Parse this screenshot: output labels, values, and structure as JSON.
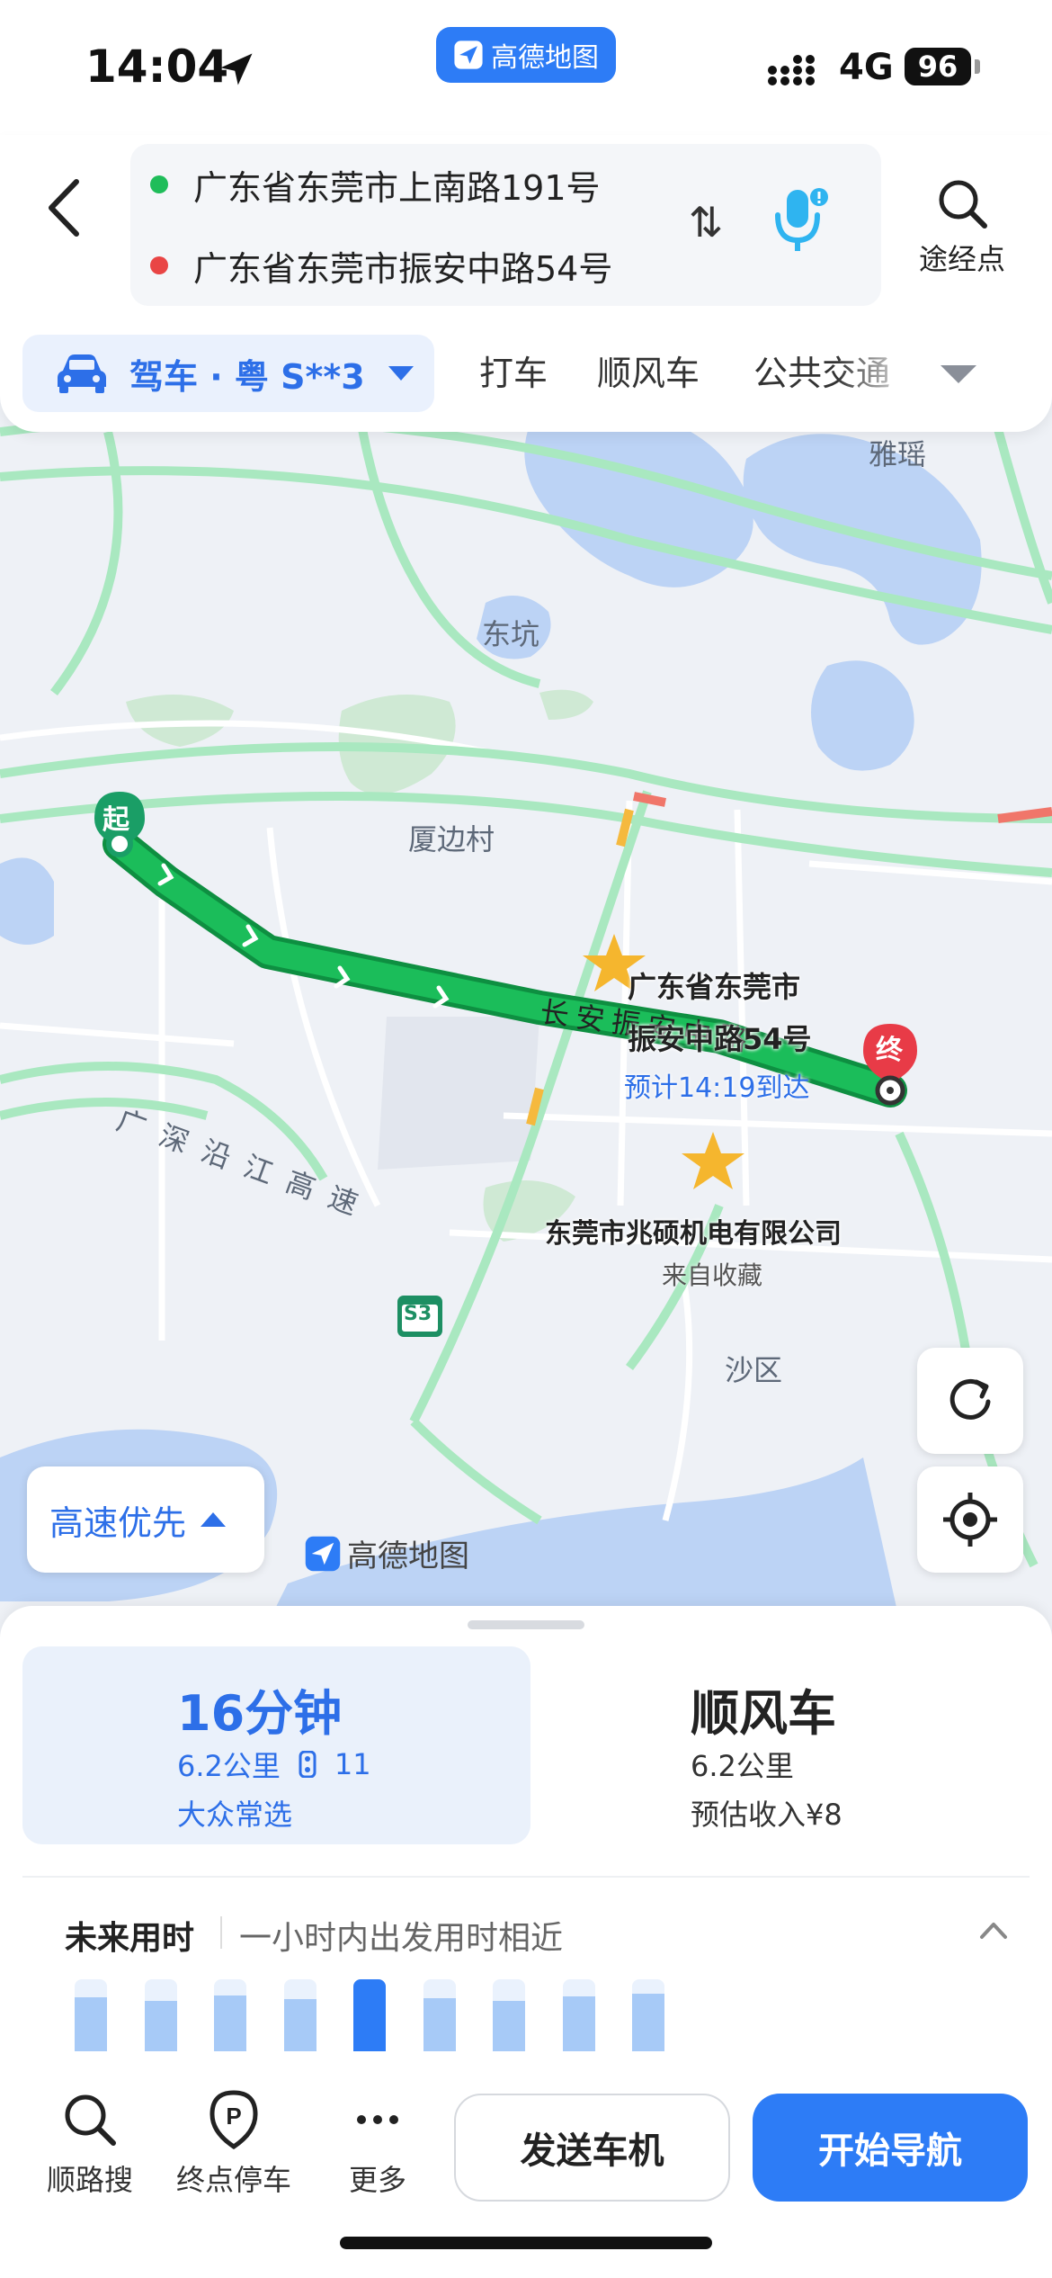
{
  "status_bar": {
    "time": "14:04",
    "network": "4G",
    "battery": "96"
  },
  "app": {
    "name": "高德地图"
  },
  "route": {
    "start": "广东省东莞市上南路191号",
    "end": "广东省东莞市振安中路54号",
    "swap_icon": "⇅",
    "via_label": "途经点",
    "icons": {
      "back": "chevron-left-icon",
      "voice": "microphone-icon",
      "via": "search-icon"
    }
  },
  "modes": {
    "active": "驾车 · 粤 S**3",
    "tabs": [
      "打车",
      "顺风车",
      "公共交通"
    ]
  },
  "map": {
    "places": [
      "雅瑶",
      "东坑",
      "厦边村",
      "沙区"
    ],
    "road_name": "长安振安中路",
    "highway_name": "广深沿江高速",
    "highway_shield": "S3",
    "start_marker": "起",
    "end_marker": "终",
    "destination_label_line1": "广东省东莞市",
    "destination_label_line2": "振安中路54号",
    "eta": "预计14:19到达",
    "poi_name": "东莞市兆硕机电有限公司",
    "poi_sub": "来自收藏",
    "preference": "高速优先",
    "logo": "高德地图",
    "colors": {
      "route": "#1bbd5a",
      "route_border": "#0e8f41",
      "road": "#a9e8c0",
      "water": "#bcd3f5"
    }
  },
  "routes": [
    {
      "title": "16分钟",
      "distance": "6.2公里",
      "lights": "11",
      "tag": "大众常选",
      "selected": true
    },
    {
      "title": "顺风车",
      "distance": "6.2公里",
      "tag": "预估收入¥8",
      "selected": false
    }
  ],
  "future": {
    "title": "未来用时",
    "subtitle": "一小时内出发用时相近",
    "bars": [
      0.75,
      0.7,
      0.78,
      0.72,
      1.0,
      0.74,
      0.7,
      0.76,
      0.8
    ],
    "active_index": 4
  },
  "toolbar": {
    "items": [
      {
        "label": "顺路搜",
        "icon": "search-icon"
      },
      {
        "label": "终点停车",
        "icon": "parking-icon"
      },
      {
        "label": "更多",
        "icon": "more-icon"
      }
    ],
    "send": "发送车机",
    "start": "开始导航"
  }
}
